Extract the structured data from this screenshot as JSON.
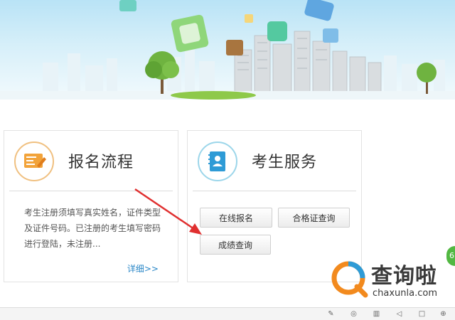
{
  "left_card": {
    "title": "报名流程",
    "icon": "registration-form-icon",
    "description": "考生注册须填写真实姓名，证件类型及证件号码。已注册的考生填写密码进行登陆，未注册...",
    "more_link": "详细>>"
  },
  "right_card": {
    "title": "考生服务",
    "icon": "address-book-icon",
    "buttons": [
      "在线报名",
      "合格证查询",
      "成绩查询"
    ]
  },
  "watermark": {
    "chinese": "查询啦",
    "english": "chaxunla.com"
  },
  "side_badge": "6",
  "colors": {
    "link": "#2a87c7",
    "arrow": "#e03030",
    "watermark_orange": "#f28a1e",
    "watermark_blue": "#2e9bd6"
  }
}
